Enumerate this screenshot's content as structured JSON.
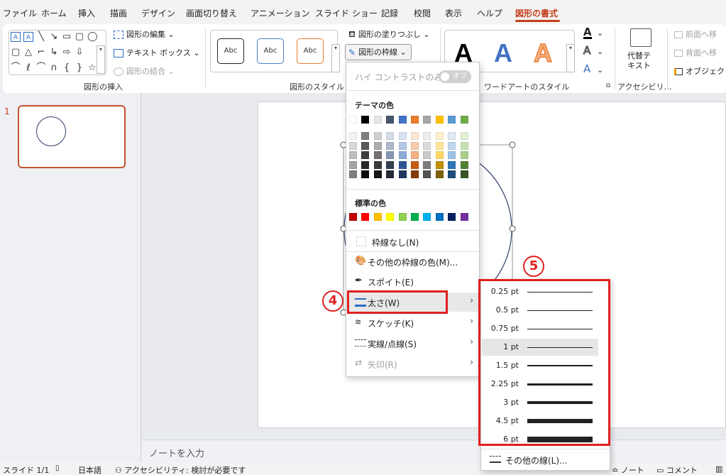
{
  "menu": {
    "tabs": [
      "ファイル",
      "ホーム",
      "挿入",
      "描画",
      "デザイン",
      "画面切り替え",
      "アニメーション",
      "スライド ショー",
      "記録",
      "校閲",
      "表示",
      "ヘルプ",
      "図形の書式"
    ],
    "active_tab": "図形の書式"
  },
  "ribbon": {
    "insert_group": {
      "label": "図形の挿入",
      "edit_shape": "図形の編集",
      "textbox": "テキスト ボックス",
      "merge": "図形の結合"
    },
    "style_group": {
      "label": "図形のスタイル",
      "samples": [
        "Abc",
        "Abc",
        "Abc"
      ],
      "fill": "図形の塗りつぶし",
      "outline": "図形の枠線"
    },
    "wordart_group": {
      "label": "ワードアートのスタイル",
      "letters": [
        "A",
        "A",
        "A"
      ]
    },
    "accessibility_group": {
      "label": "アクセシビリ…",
      "alt_text": "代替テキスト",
      "alt_text_line1": "代替テ",
      "alt_text_line2": "キスト"
    },
    "arrange_group": {
      "bring_forward": "前面へ移",
      "send_backward": "背面へ移",
      "selection_pane": "オブジェクト"
    }
  },
  "slides_panel": {
    "slide_number": "1"
  },
  "notes": {
    "placeholder": "ノートを入力"
  },
  "status": {
    "slide": "スライド 1/1",
    "language": "日本語",
    "accessibility": "アクセシビリティ: 検討が必要です",
    "notes_btn": "ノート",
    "comments_btn": "コメント"
  },
  "outline_menu": {
    "high_contrast": "ハイ コントラストのみ(H)",
    "toggle": "オフ",
    "theme_colors_heading": "テーマの色",
    "standard_colors_heading": "標準の色",
    "no_outline": "枠線なし(N)",
    "more_colors": "その他の枠線の色(M)...",
    "eyedropper": "スポイト(E)",
    "weight": "太さ(W)",
    "sketch": "スケッチ(K)",
    "dashes": "実線/点線(S)",
    "arrows": "矢印(R)",
    "theme_colors": {
      "top": [
        "#ffffff",
        "#000000",
        "#e7e6e6",
        "#44546a",
        "#4472c4",
        "#ed7d31",
        "#a5a5a5",
        "#ffc000",
        "#5b9bd5",
        "#70ad47"
      ],
      "shades": [
        [
          "#f2f2f2",
          "#7f7f7f",
          "#d0cece",
          "#d6dce4",
          "#d9e2f3",
          "#fbe5d5",
          "#ededed",
          "#fff2cc",
          "#deebf6",
          "#e2efd9"
        ],
        [
          "#d8d8d8",
          "#595959",
          "#aeabab",
          "#adb9ca",
          "#b4c6e7",
          "#f7cbac",
          "#dbdbdb",
          "#fee599",
          "#bdd7ee",
          "#c5e0b3"
        ],
        [
          "#bfbfbf",
          "#3f3f3f",
          "#757070",
          "#8496b0",
          "#8eaadb",
          "#f4b183",
          "#c9c9c9",
          "#ffd965",
          "#9cc3e5",
          "#a8d08d"
        ],
        [
          "#a5a5a5",
          "#262626",
          "#3a3838",
          "#323f4f",
          "#2f5496",
          "#c55a11",
          "#7b7b7b",
          "#bf9000",
          "#2e75b5",
          "#538135"
        ],
        [
          "#7f7f7f",
          "#0c0c0c",
          "#171616",
          "#222a35",
          "#1f3864",
          "#833c0b",
          "#525252",
          "#7f6000",
          "#1e4e79",
          "#375623"
        ]
      ]
    },
    "standard_colors": [
      "#c00000",
      "#ff0000",
      "#ffc000",
      "#ffff00",
      "#92d050",
      "#00b050",
      "#00b0f0",
      "#0070c0",
      "#002060",
      "#7030a0"
    ]
  },
  "weight_menu": {
    "weights": [
      {
        "label": "0.25 pt",
        "pt": 0.25
      },
      {
        "label": "0.5 pt",
        "pt": 0.5
      },
      {
        "label": "0.75 pt",
        "pt": 0.75
      },
      {
        "label": "1 pt",
        "pt": 1
      },
      {
        "label": "1.5 pt",
        "pt": 1.5
      },
      {
        "label": "2.25 pt",
        "pt": 2.25
      },
      {
        "label": "3 pt",
        "pt": 3
      },
      {
        "label": "4.5 pt",
        "pt": 4.5
      },
      {
        "label": "6 pt",
        "pt": 6
      }
    ],
    "selected": "1 pt",
    "more_lines": "その他の線(L)..."
  },
  "annotations": {
    "badge4": "4",
    "badge5": "5",
    "color": "#e02020"
  }
}
